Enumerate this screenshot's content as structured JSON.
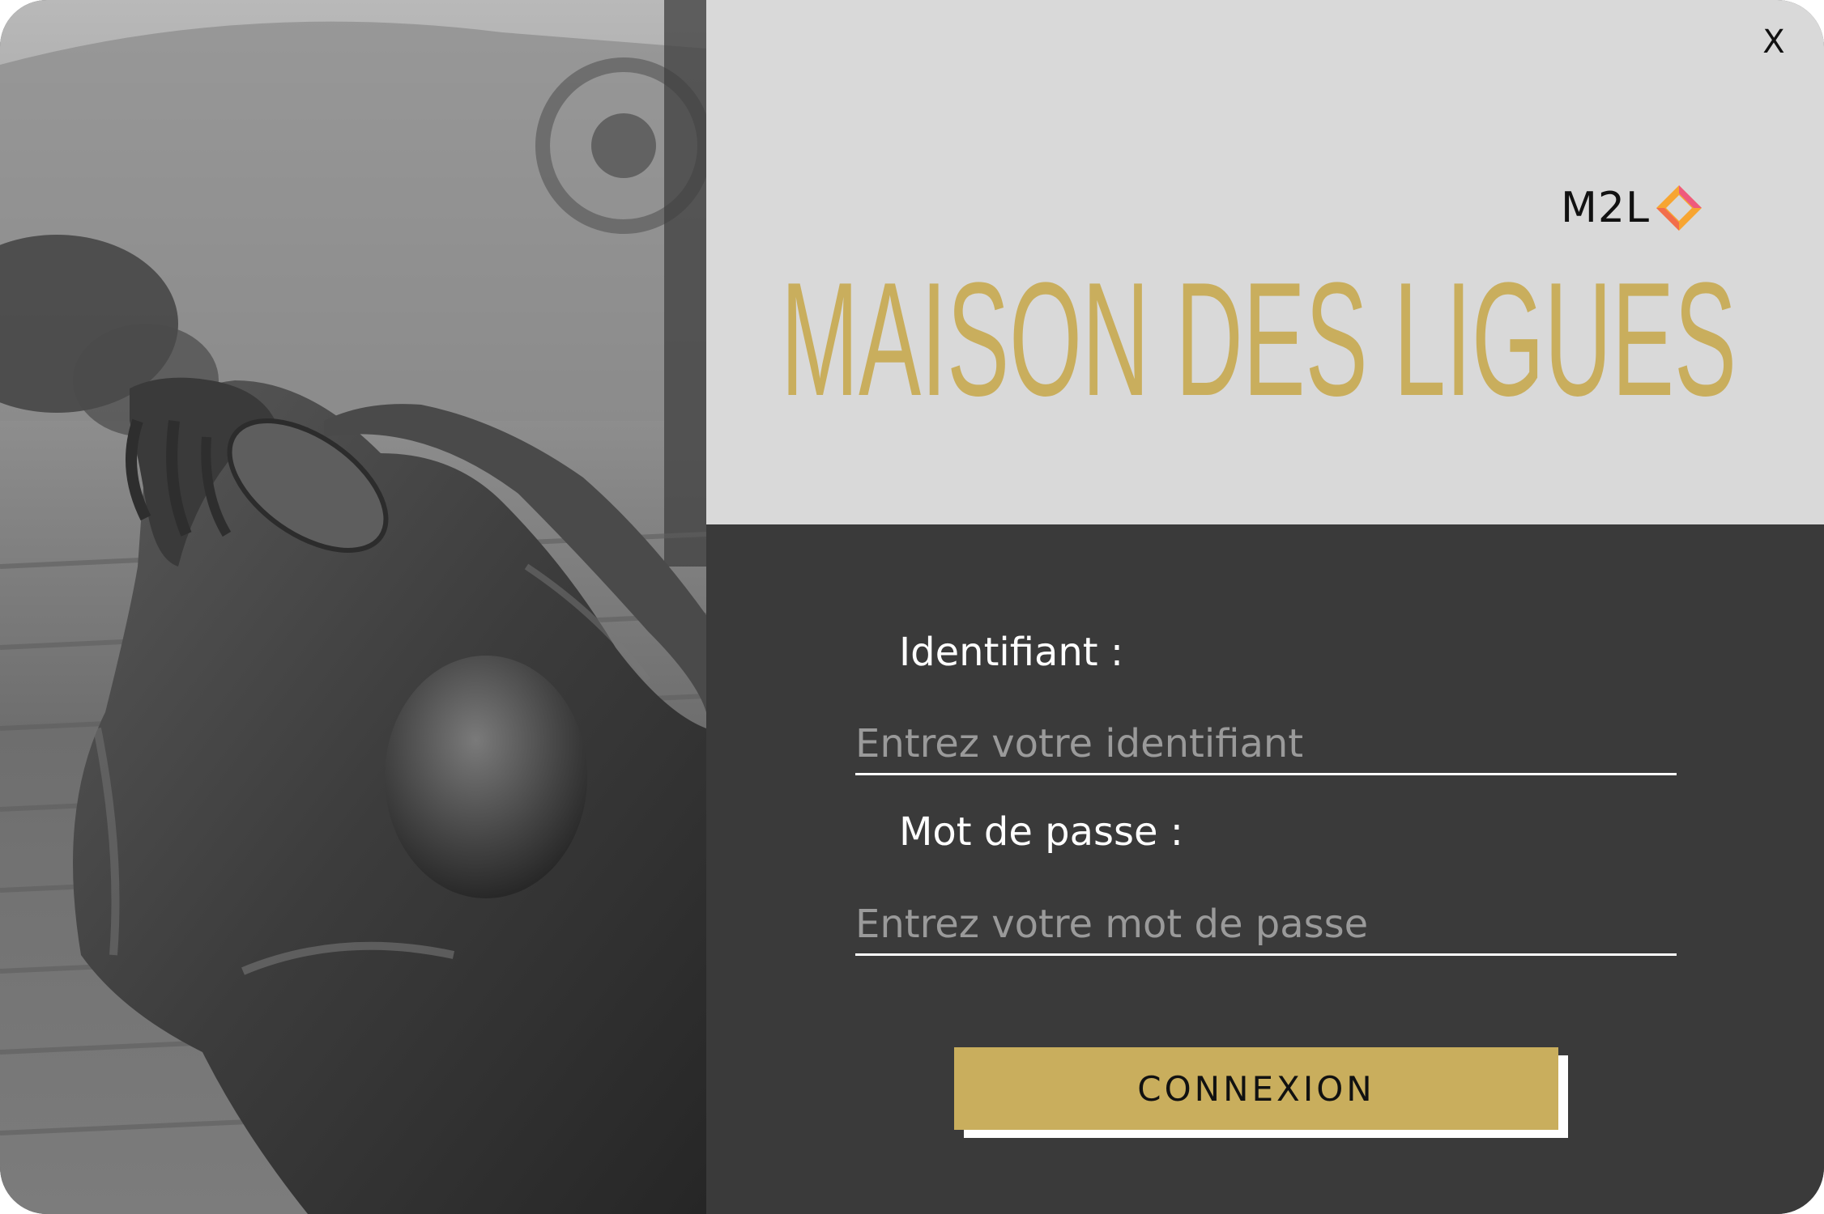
{
  "window": {
    "close_label": "X"
  },
  "header": {
    "logo_text": "M2L",
    "title": "MAISON DES LIGUES"
  },
  "form": {
    "identifier_label": "Identifiant :",
    "identifier_placeholder": "Entrez votre identifiant",
    "identifier_value": "",
    "password_label": "Mot de passe :",
    "password_placeholder": "Entrez votre mot de passe",
    "password_value": "",
    "submit_label": "CONNEXION"
  },
  "colors": {
    "brand_gold": "#c9ae5d",
    "header_bg": "#d9d9d9",
    "panel_bg": "#3a3a3a",
    "logo_orange": "#f7a531",
    "logo_pink": "#ef5a7d"
  },
  "icons": {
    "photo": "discus-thrower-statue-photo",
    "logo_mark": "m2l-diamond-logo-icon",
    "close": "close-icon"
  }
}
